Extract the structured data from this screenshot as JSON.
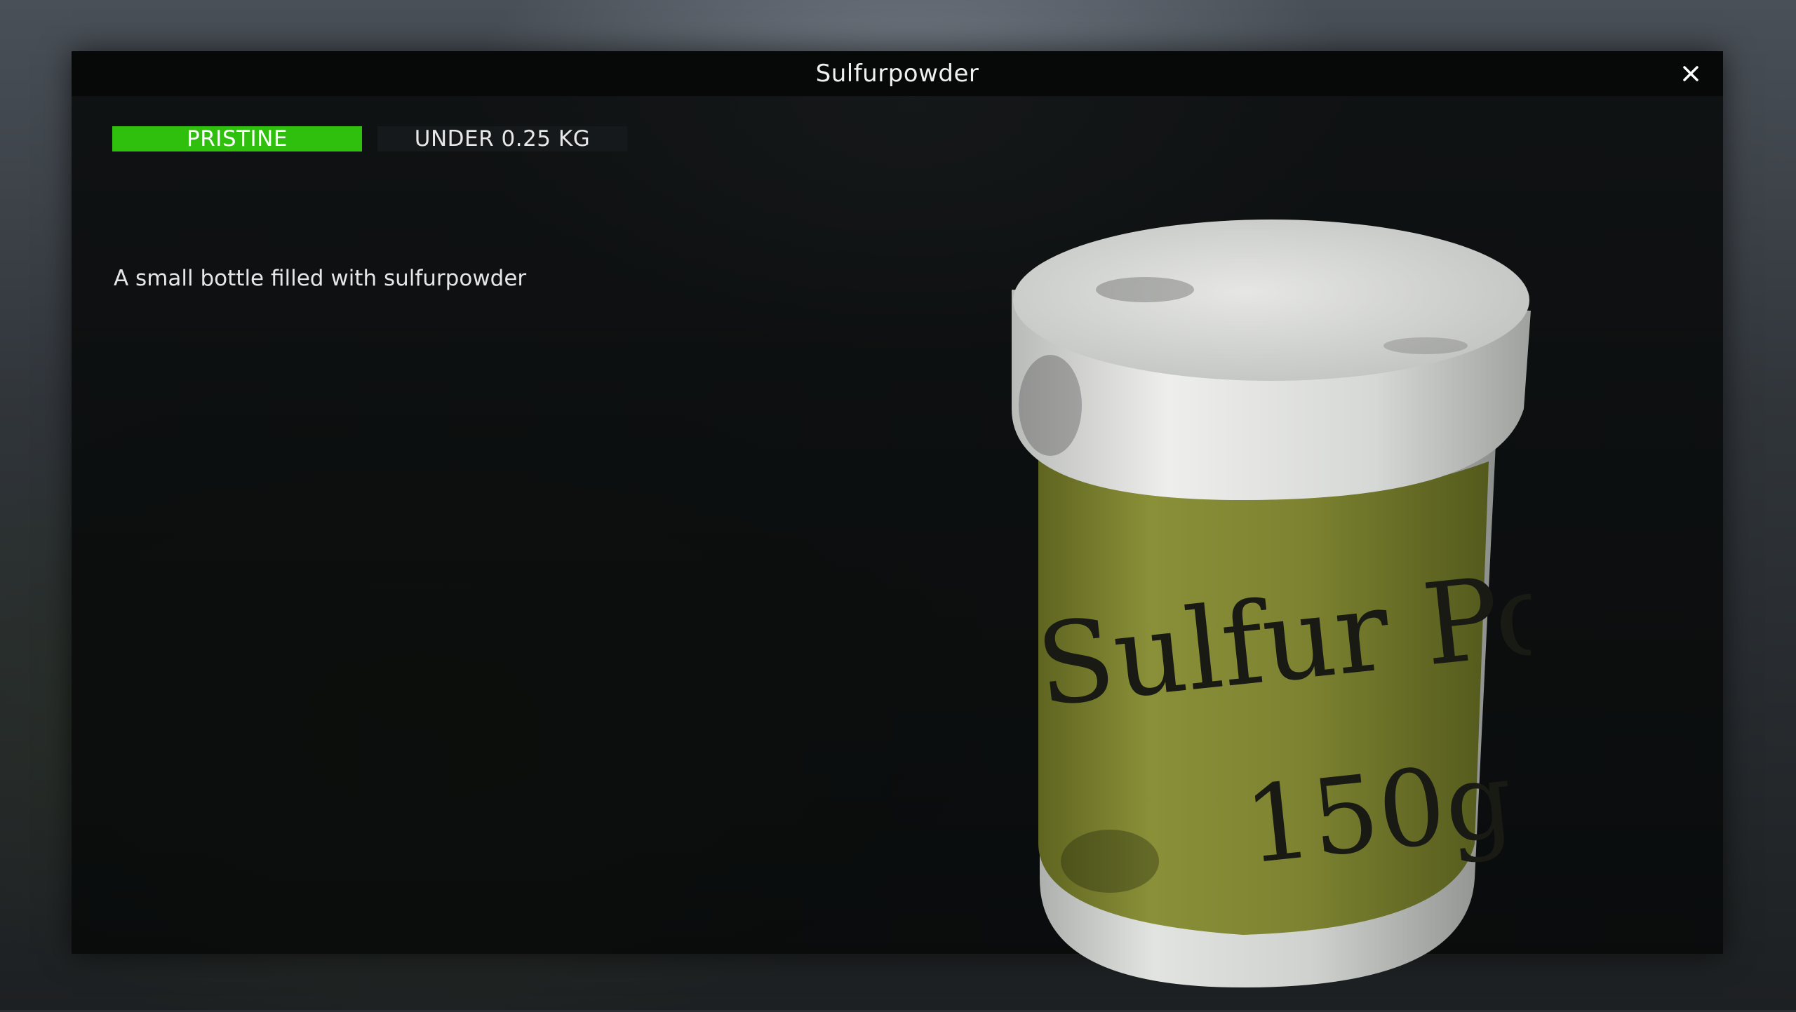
{
  "window": {
    "title": "Sulfurpowder",
    "close_icon": "close-icon"
  },
  "item": {
    "condition": "PRISTINE",
    "condition_color": "#2fc00d",
    "weight": "UNDER 0.25 KG",
    "description": "A small bottle filled with sulfurpowder"
  },
  "preview": {
    "label_line1": "Sulfur Po",
    "label_line2": "150g",
    "label_color": "#7a7f2c",
    "cap_color": "#c9cbc9"
  }
}
